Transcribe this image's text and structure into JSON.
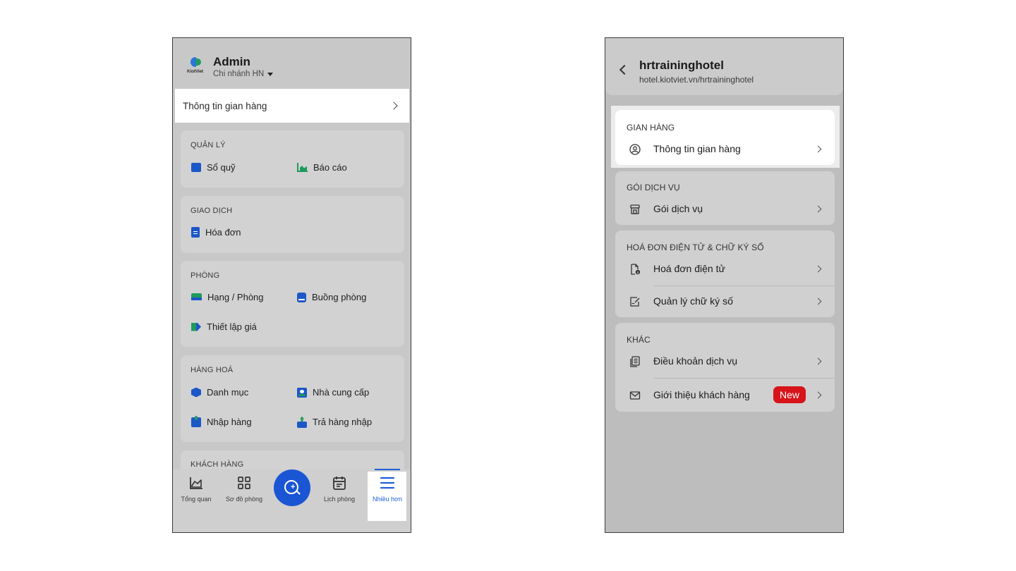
{
  "left_screen": {
    "header": {
      "logo_text": "KiotViet",
      "user_name": "Admin",
      "branch": "Chi nhánh HN"
    },
    "store_info_row": "Thông tin gian hàng",
    "sections": [
      {
        "title": "QUẢN LÝ",
        "items": [
          {
            "label": "Sổ quỹ",
            "icon": "wallet-icon",
            "color": "#1c57c8"
          },
          {
            "label": "Báo cáo",
            "icon": "chart-icon",
            "color": "#1f9b5c"
          }
        ]
      },
      {
        "title": "GIAO DỊCH",
        "items": [
          {
            "label": "Hóa đơn",
            "icon": "invoice-icon",
            "color": "#1c57c8"
          }
        ]
      },
      {
        "title": "PHÒNG",
        "items": [
          {
            "label": "Hạng / Phòng",
            "icon": "bed-icon",
            "color": "#1f9b5c"
          },
          {
            "label": "Buồng phòng",
            "icon": "room-icon",
            "color": "#1c57c8"
          },
          {
            "label": "Thiết lập giá",
            "icon": "price-tag-icon",
            "color": "#1f9b5c"
          }
        ]
      },
      {
        "title": "HÀNG HOÁ",
        "items": [
          {
            "label": "Danh mục",
            "icon": "box-icon",
            "color": "#1c57c8"
          },
          {
            "label": "Nhà cung cấp",
            "icon": "supplier-icon",
            "color": "#1c57c8"
          },
          {
            "label": "Nhập hàng",
            "icon": "import-icon",
            "color": "#1c57c8"
          },
          {
            "label": "Trả hàng nhập",
            "icon": "return-icon",
            "color": "#1c57c8"
          }
        ]
      },
      {
        "title": "KHÁCH HÀNG",
        "items": []
      }
    ],
    "bottom_nav": [
      {
        "label": "Tổng quan",
        "icon": "overview-chart-icon"
      },
      {
        "label": "Sơ đồ phòng",
        "icon": "grid-icon"
      },
      {
        "label": "",
        "icon": "search-plus-icon"
      },
      {
        "label": "Lịch phòng",
        "icon": "calendar-icon"
      },
      {
        "label": "Nhiều hơn",
        "icon": "menu-icon",
        "active": true
      }
    ],
    "accent": "#1a55d4"
  },
  "right_screen": {
    "header": {
      "title": "hrtraininghotel",
      "url": "hotel.kiotviet.vn/hrtraininghotel"
    },
    "sections": [
      {
        "title": "GIAN HÀNG",
        "items": [
          {
            "label": "Thông tin gian hàng",
            "icon": "user-circle-icon"
          }
        ]
      },
      {
        "title": "GÓI DỊCH VỤ",
        "items": [
          {
            "label": "Gói dịch vụ",
            "icon": "store-icon"
          }
        ]
      },
      {
        "title": "HOÁ ĐƠN ĐIỆN TỬ & CHỮ KÝ SỐ",
        "items": [
          {
            "label": "Hoá đơn điện tử",
            "icon": "e-invoice-icon"
          },
          {
            "label": "Quản lý chữ ký số",
            "icon": "signature-icon"
          }
        ]
      },
      {
        "title": "KHÁC",
        "items": [
          {
            "label": "Điều khoản dịch vụ",
            "icon": "terms-icon"
          },
          {
            "label": "Giới thiệu khách hàng",
            "icon": "mail-icon",
            "badge": "New"
          }
        ]
      }
    ],
    "badge_color": "#d7141a"
  }
}
